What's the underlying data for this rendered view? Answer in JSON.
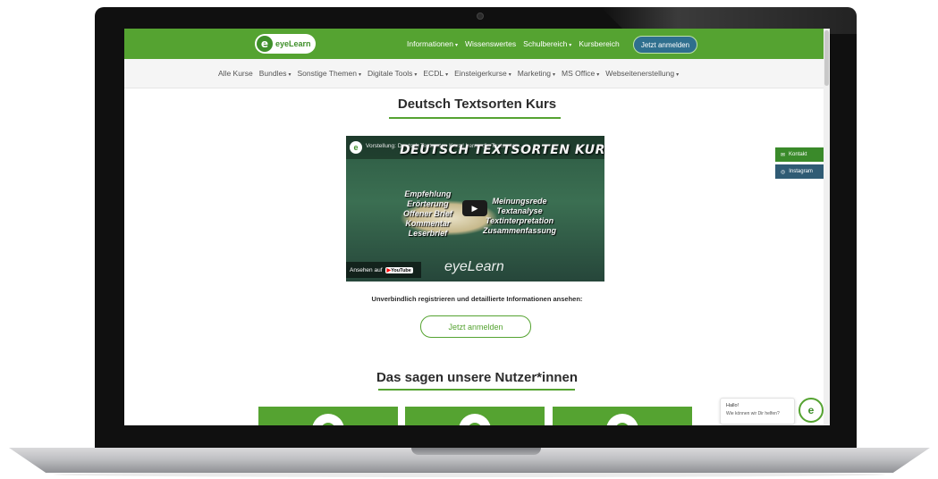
{
  "header": {
    "logo_letter": "e",
    "logo_text": "eyeLearn",
    "nav": [
      {
        "label": "Informationen",
        "has_dropdown": true
      },
      {
        "label": "Wissenswertes",
        "has_dropdown": false
      },
      {
        "label": "Schulbereich",
        "has_dropdown": true
      },
      {
        "label": "Kursbereich",
        "has_dropdown": false
      }
    ],
    "cta_label": "Jetzt anmelden"
  },
  "subnav": [
    "Alle Kurse",
    "Bundles",
    "Sonstige Themen",
    "Digitale Tools",
    "ECDL",
    "Einsteigerkurse",
    "Marketing",
    "MS Office",
    "Webseitenerstellung"
  ],
  "subnav_dropdown": [
    false,
    true,
    true,
    true,
    true,
    true,
    true,
    true,
    true
  ],
  "caret": "▾",
  "main": {
    "title": "Deutsch Textsorten Kurs",
    "video": {
      "caption": "Vorstellung: Deutsch Textsorten Kurs | Lerne die Textsorten...",
      "headline": "DEUTSCH TEXTSORTEN KURS",
      "left_words": [
        "Empfehlung",
        "Erörterung",
        "Offener Brief",
        "Kommentar",
        "Leserbrief"
      ],
      "right_words": [
        "Meinungsrede",
        "Textanalyse",
        "Textinterpretation",
        "Zusammenfassung"
      ],
      "watch_on": "Ansehen auf",
      "youtube_label": "YouTube",
      "brand": "eyeLearn",
      "play_symbol": "▶"
    },
    "register_text": "Unverbindlich registrieren und detaillierte Informationen ansehen:",
    "register_button": "Jetzt anmelden",
    "testimonials_title": "Das sagen unsere Nutzer*innen",
    "testimonial_cards": 3
  },
  "side_buttons": [
    {
      "label": "Kontakt",
      "icon": "mail-icon",
      "glyph": "✉"
    },
    {
      "label": "Instagram",
      "icon": "instagram-icon",
      "glyph": "◎"
    }
  ],
  "chat": {
    "greeting": "Hallo!",
    "message": "Wie können wir Dir helfen?",
    "avatar_letter": "e"
  },
  "colors": {
    "brand_green": "#55a331",
    "cta_blue": "#2f6f8e",
    "instagram_blue": "#2f5b74"
  }
}
